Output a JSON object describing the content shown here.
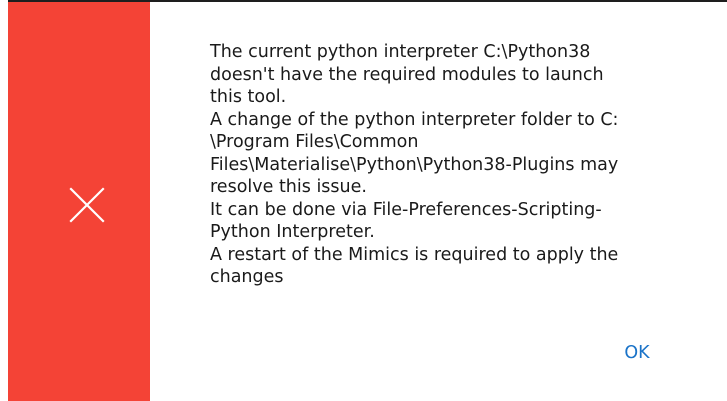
{
  "dialog": {
    "accent_color": "#f44336",
    "icon": "close-icon",
    "message_lines": [
      "The current python interpreter C:\\Python38",
      "doesn't have the required modules to launch",
      "this tool.",
      "A change of the python interpreter folder to C:",
      "\\Program Files\\Common",
      "Files\\Materialise\\Python\\Python38-Plugins may",
      "resolve this issue.",
      "It can be done via File-Preferences-Scripting-",
      "Python Interpreter.",
      "A restart of the Mimics is required to apply the",
      "changes"
    ],
    "ok_label": "OK",
    "ok_color": "#1a73c8"
  }
}
